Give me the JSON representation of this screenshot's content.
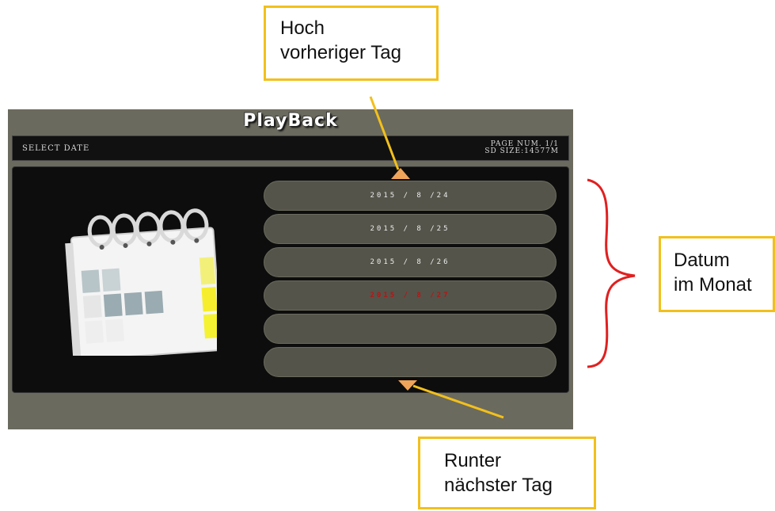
{
  "screen": {
    "title": "PlayBack",
    "select_date": "SELECT DATE",
    "page_num": "PAGE NUM. 1/1",
    "sd_size": "SD SIZE:14577M"
  },
  "dates": [
    {
      "label": "2015 / 8 /24",
      "selected": false
    },
    {
      "label": "2015 / 8 /25",
      "selected": false
    },
    {
      "label": "2015 / 8 /26",
      "selected": false
    },
    {
      "label": "2015 / 8 /27",
      "selected": true
    },
    {
      "label": "",
      "selected": false
    },
    {
      "label": "",
      "selected": false
    }
  ],
  "callouts": {
    "up": {
      "line1": "Hoch",
      "line2": "vorheriger Tag"
    },
    "down": {
      "line1": "Runter",
      "line2": "nächster Tag"
    },
    "date": {
      "line1": "Datum",
      "line2": "im Monat"
    }
  },
  "colors": {
    "callout_border": "#f2c01c",
    "arrow": "#f0a45a",
    "bracket": "#e02020",
    "selected_text": "#b51616"
  },
  "icons": {
    "calendar": "calendar-icon",
    "up": "arrow-up-icon",
    "down": "arrow-down-icon"
  }
}
